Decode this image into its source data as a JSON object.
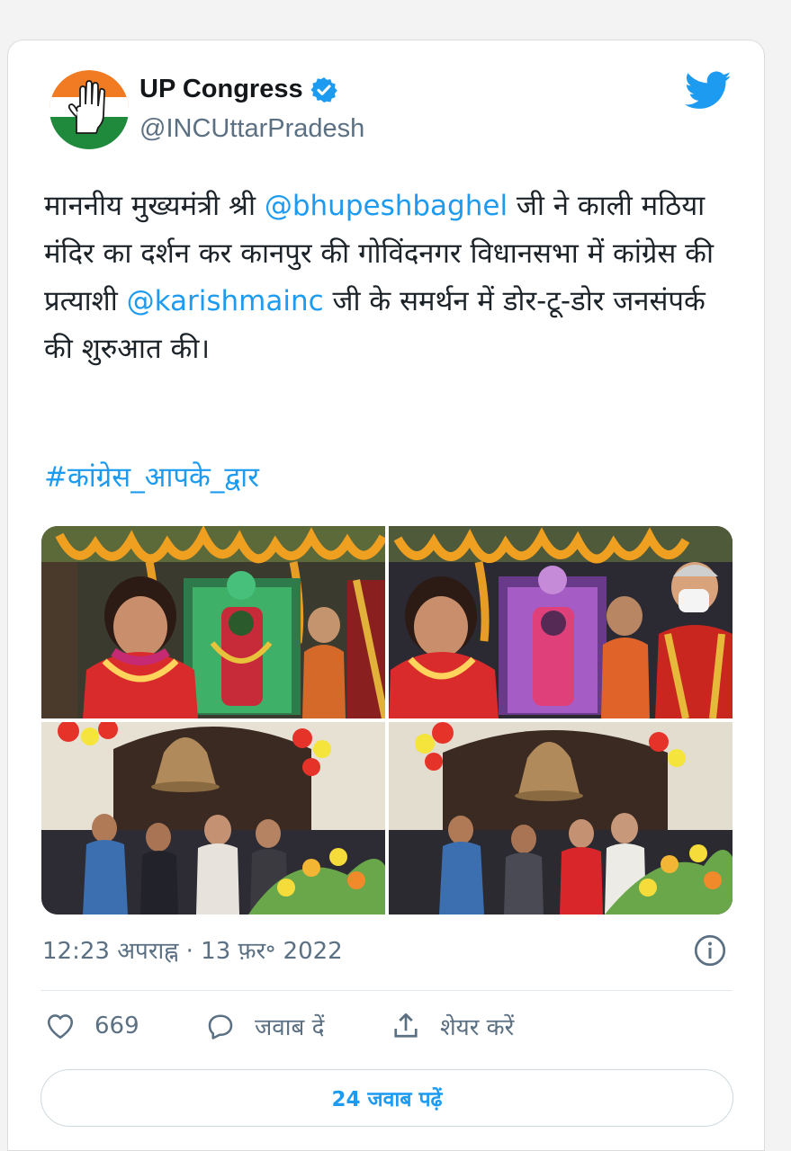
{
  "account": {
    "display_name": "UP Congress",
    "handle": "@INCUttarPradesh",
    "verified": true,
    "avatar_icon": "congress-hand-logo-icon"
  },
  "tweet": {
    "text_parts": [
      "माननीय मुख्यमंत्री श्री ",
      "@bhupeshbaghel",
      " जी ने काली मठिया मंदिर का दर्शन कर कानपुर की गोविंदनगर विधानसभा में कांग्रेस की प्रत्याशी ",
      "@karishmainc",
      " जी के समर्थन में डोर-टू-डोर जनसंपर्क की शुरुआत की।"
    ],
    "hashtag": "#कांग्रेस_आपके_द्वार",
    "timestamp": "12:23 अपराह्न · 13 फ़र॰ 2022"
  },
  "media": {
    "photos": [
      {
        "scene": "temple-darshan-green-light"
      },
      {
        "scene": "temple-darshan-purple-light"
      },
      {
        "scene": "bell-crowd-left"
      },
      {
        "scene": "bell-crowd-right"
      }
    ]
  },
  "actions": {
    "like_icon": "heart-icon",
    "like_count": "669",
    "reply_icon": "reply-bubble-icon",
    "reply_label": "जवाब दें",
    "share_icon": "share-icon",
    "share_label": "शेयर करें"
  },
  "read_replies_label": "24 जवाब पढ़ें",
  "colors": {
    "accent": "#1d9bf0",
    "text_primary": "#14171a",
    "text_secondary": "#5b7083",
    "saffron": "#f07b22",
    "india_green": "#1f8a3c"
  }
}
